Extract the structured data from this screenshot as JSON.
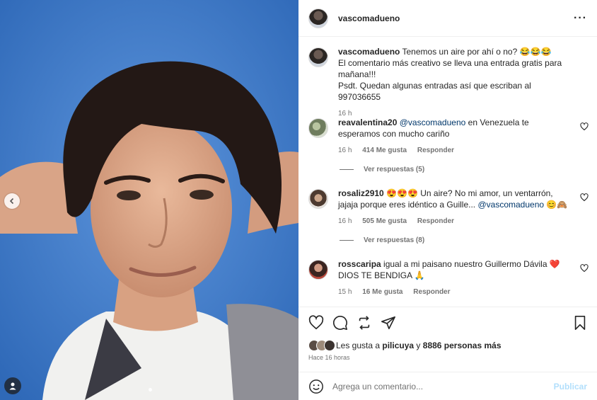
{
  "post": {
    "username": "vascomadueno",
    "caption": {
      "username": "vascomadueno",
      "line1": "Tenemos un aire por ahí o no? 😂😂😂",
      "line2": "El comentario más creativo se lleva una entrada gratis para mañana!!!",
      "line3": "Psdt. Quedan algunas entradas así que escriban al 997036655",
      "time": "16 h"
    }
  },
  "comments": [
    {
      "username": "reavalentina20",
      "mention": "@vascomadueno",
      "text": "en Venezuela te esperamos con mucho cariño",
      "time": "16 h",
      "likes": "414 Me gusta",
      "reply": "Responder",
      "view_replies": "Ver respuestas (5)"
    },
    {
      "username": "rosaliz2910",
      "text": "😍😍😍 Un aire? No mi amor, un ventarrón, jajaja porque eres idéntico a Guille...",
      "mention": "@vascomadueno",
      "tail": "😊🙈",
      "time": "16 h",
      "likes": "505 Me gusta",
      "reply": "Responder",
      "view_replies": "Ver respuestas (8)"
    },
    {
      "username": "rosscaripa",
      "text": "igual a mi paisano nuestro Guillermo Dávila ❤️ DIOS TE BENDIGA 🙏",
      "time": "15 h",
      "likes": "16 Me gusta",
      "reply": "Responder"
    }
  ],
  "likes": {
    "prefix": "Les gusta a",
    "user": "pilicuya",
    "connector": "y",
    "count": "8886 personas más"
  },
  "time_ago": "Hace 16 horas",
  "compose": {
    "placeholder": "Agrega un comentario...",
    "post_label": "Publicar"
  },
  "colors": {
    "photo_background": "#3f7fd0",
    "mention": "#00376b",
    "post_button_disabled": "#b2dffc"
  },
  "icons": [
    "heart-icon",
    "comment-icon",
    "share-icon",
    "send-icon",
    "bookmark-icon",
    "more-icon",
    "emoji-icon",
    "chevron-left-icon",
    "user-tag-icon"
  ]
}
